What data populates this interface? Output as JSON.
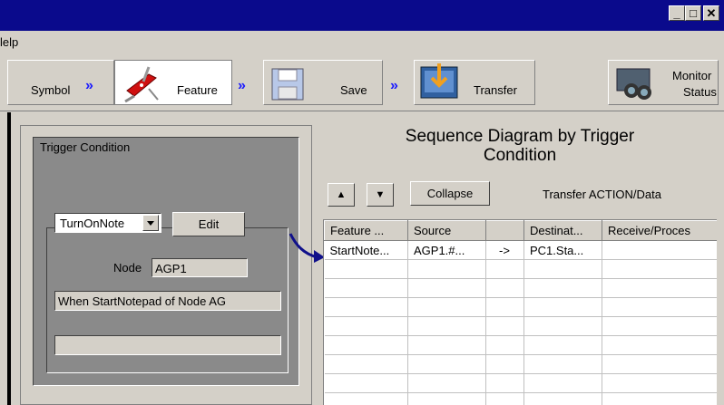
{
  "window": {
    "min": "_",
    "max": "□",
    "close": "✕"
  },
  "menu": {
    "help": "lelp"
  },
  "toolbar": {
    "symbol": "Symbol",
    "feature": "Feature",
    "save": "Save",
    "transfer": "Transfer",
    "monitor_line1": "Monitor",
    "monitor_line2": "Status",
    "chevron": "»"
  },
  "trigger": {
    "title": "Trigger Condition",
    "dropdown_value": "TurnOnNote",
    "edit": "Edit",
    "node_label": "Node",
    "node_value": "AGP1",
    "condition_text": "When StartNotepad of Node AG",
    "extra_field": ""
  },
  "sequence": {
    "title_line1": "Sequence Diagram by Trigger",
    "title_line2": "Condition",
    "up": "▲",
    "down": "▼",
    "collapse": "Collapse",
    "transfer_label": "Transfer ACTION/Data",
    "columns": [
      "Feature ...",
      "Source",
      "",
      "Destinat...",
      "Receive/Proces"
    ],
    "row": [
      "StartNote...",
      "AGP1.#...",
      "->",
      "PC1.Sta...",
      ""
    ]
  },
  "colors": {
    "titlebar": "#0a0a8c",
    "face": "#d4d0c8",
    "arrow": "#10108a"
  }
}
